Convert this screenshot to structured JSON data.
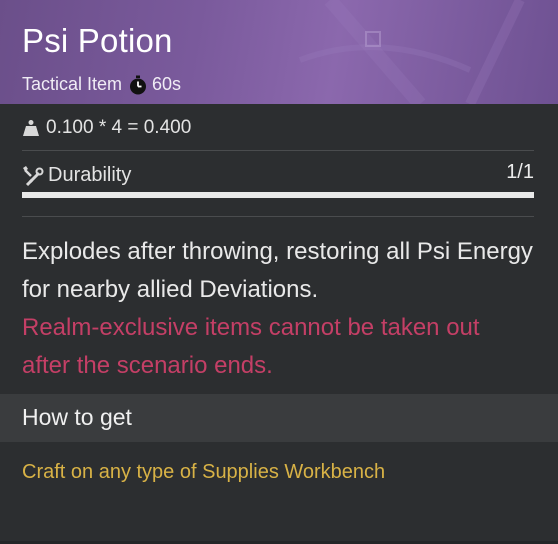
{
  "item": {
    "name": "Psi Potion",
    "category": "Tactical Item",
    "cooldown": "60s",
    "header_color": "#7a5a9c"
  },
  "weight": {
    "text": "0.100 * 4 = 0.400",
    "icon": "weight-icon"
  },
  "durability": {
    "label": "Durability",
    "value": "1/1",
    "fraction": 1.0,
    "icon": "wrench-icon"
  },
  "description": {
    "text": "Explodes after throwing, restoring all Psi Energy for nearby allied Deviations.",
    "warning": "Realm-exclusive items cannot be taken out after the scenario ends.",
    "warning_color": "#c43f66"
  },
  "how_to_get": {
    "title": "How to get",
    "source": "Craft on any type of Supplies Workbench",
    "source_color": "#d8b246"
  }
}
